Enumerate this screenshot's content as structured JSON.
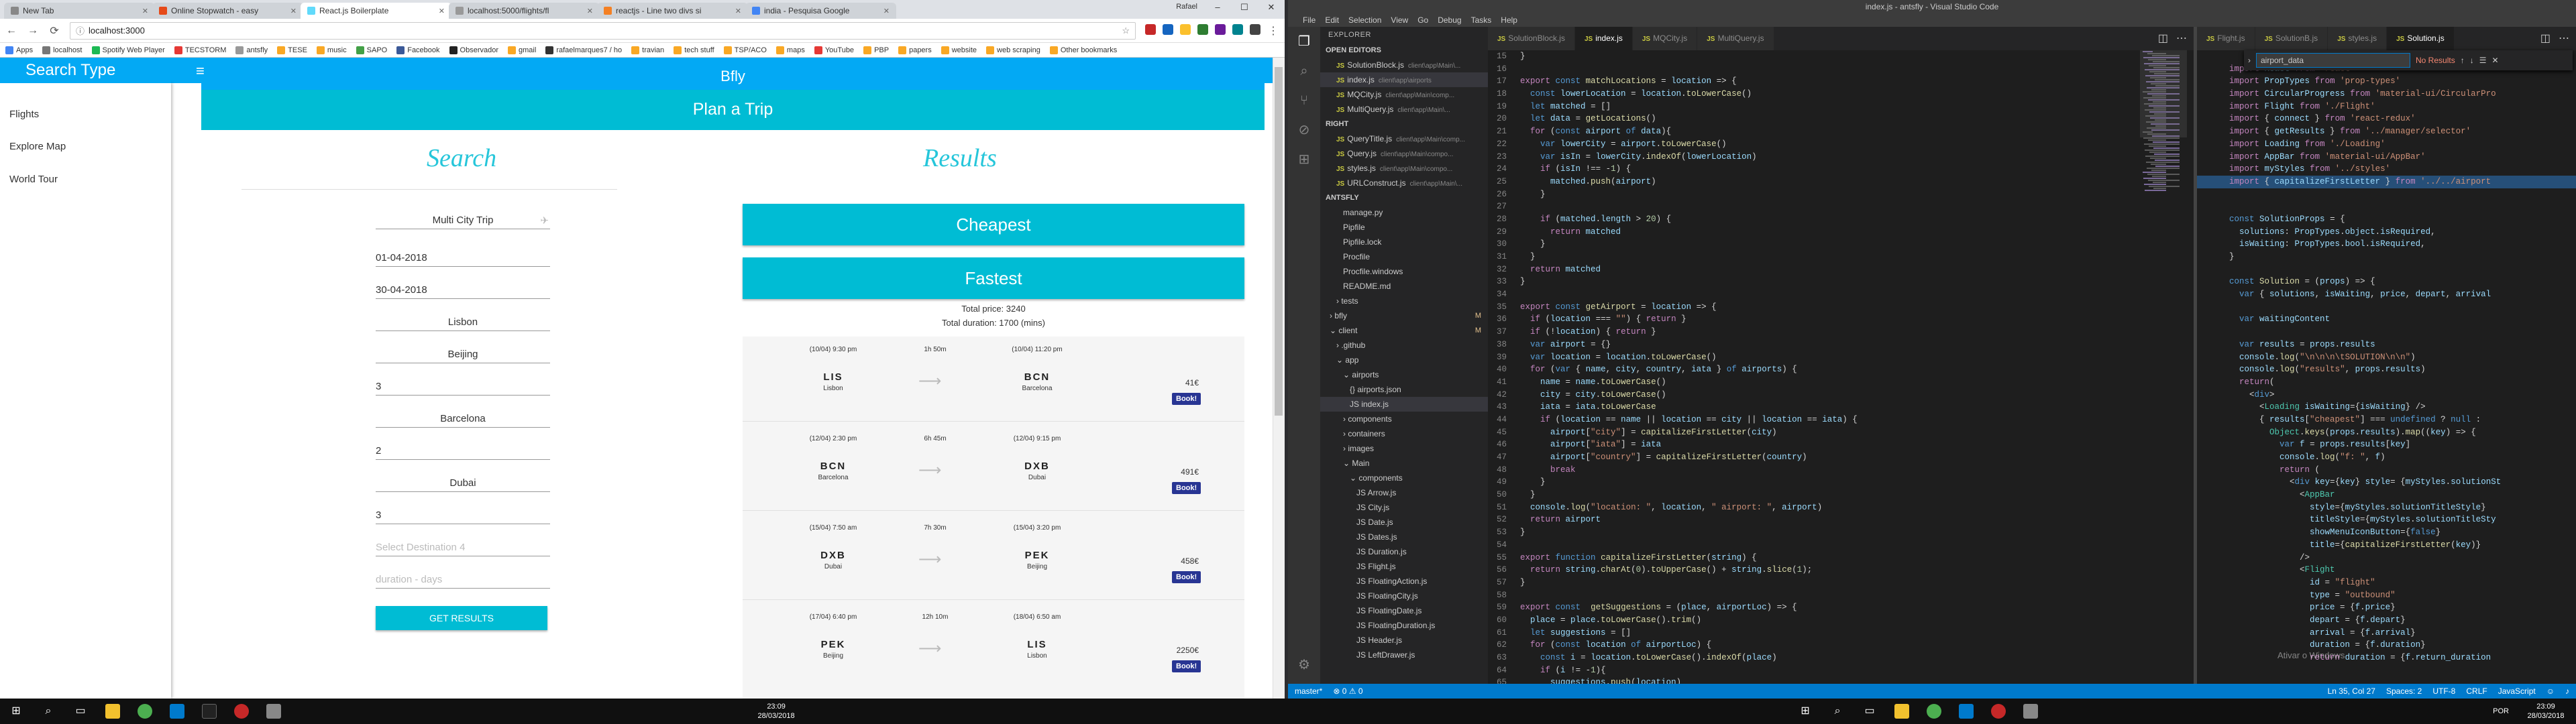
{
  "browser": {
    "tabs": [
      {
        "title": "New Tab",
        "color": "#888"
      },
      {
        "title": "Online Stopwatch - easy",
        "color": "#e64a19"
      },
      {
        "title": "React.js Boilerplate",
        "color": "#61dafb"
      },
      {
        "title": "localhost:5000/flights/fl",
        "color": "#999"
      },
      {
        "title": "reactjs - Line two divs si",
        "color": "#f48024"
      },
      {
        "title": "india - Pesquisa Google",
        "color": "#4285f4"
      }
    ],
    "user": "Rafael",
    "url": "localhost:3000",
    "bookmarks": [
      {
        "label": "Apps",
        "color": "#4285f4"
      },
      {
        "label": "localhost",
        "color": "#777"
      },
      {
        "label": "Spotify Web Player",
        "color": "#1db954"
      },
      {
        "label": "TECSTORM",
        "color": "#e53935"
      },
      {
        "label": "antsfly",
        "color": "#999"
      },
      {
        "label": "TESE",
        "color": "#f9a825"
      },
      {
        "label": "music",
        "color": "#f9a825"
      },
      {
        "label": "SAPO",
        "color": "#43a047"
      },
      {
        "label": "Facebook",
        "color": "#3b5998"
      },
      {
        "label": "Observador",
        "color": "#222"
      },
      {
        "label": "gmail",
        "color": "#f9a825"
      },
      {
        "label": "rafaelmarques7 / ho",
        "color": "#333"
      },
      {
        "label": "travian",
        "color": "#f9a825"
      },
      {
        "label": "tech stuff",
        "color": "#f9a825"
      },
      {
        "label": "TSP/ACO",
        "color": "#f9a825"
      },
      {
        "label": "maps",
        "color": "#f9a825"
      },
      {
        "label": "YouTube",
        "color": "#e53935"
      },
      {
        "label": "PBP",
        "color": "#f9a825"
      },
      {
        "label": "papers",
        "color": "#f9a825"
      },
      {
        "label": "website",
        "color": "#f9a825"
      },
      {
        "label": "web scraping",
        "color": "#f9a825"
      },
      {
        "label": "Other bookmarks",
        "color": "#f9a825"
      }
    ]
  },
  "app": {
    "drawer_title": "Search Type",
    "nav": [
      "Flights",
      "Explore Map",
      "World Tour"
    ],
    "brand": "Bfly",
    "header": "Plan a Trip",
    "search": {
      "title": "Search",
      "mode": "Multi City Trip",
      "date_from": "01-04-2018",
      "date_to": "30-04-2018",
      "origin": "Lisbon",
      "destinations": [
        {
          "city": "Beijing",
          "days": "3"
        },
        {
          "city": "Barcelona",
          "days": "2"
        },
        {
          "city": "Dubai",
          "days": "3"
        }
      ],
      "dest_placeholder": "Select Destination 4",
      "days_placeholder": "duration - days",
      "submit": "GET RESULTS"
    },
    "results": {
      "title": "Results",
      "cheapest": "Cheapest",
      "fastest": "Fastest",
      "total_price": "Total price: 3240",
      "total_duration": "Total duration: 1700 (mins)",
      "book_label": "Book!",
      "flights": [
        {
          "dep_time": "(10/04) 9:30 pm",
          "duration": "1h 50m",
          "arr_time": "(10/04) 11:20 pm",
          "from_code": "LIS",
          "from_city": "Lisbon",
          "to_code": "BCN",
          "to_city": "Barcelona",
          "price": "41€"
        },
        {
          "dep_time": "(12/04) 2:30 pm",
          "duration": "6h 45m",
          "arr_time": "(12/04) 9:15 pm",
          "from_code": "BCN",
          "from_city": "Barcelona",
          "to_code": "DXB",
          "to_city": "Dubai",
          "price": "491€"
        },
        {
          "dep_time": "(15/04) 7:50 am",
          "duration": "7h 30m",
          "arr_time": "(15/04) 3:20 pm",
          "from_code": "DXB",
          "from_city": "Dubai",
          "to_code": "PEK",
          "to_city": "Beijing",
          "price": "458€"
        },
        {
          "dep_time": "(17/04) 6:40 pm",
          "duration": "12h 10m",
          "arr_time": "(18/04) 6:50 am",
          "from_code": "PEK",
          "from_city": "Beijing",
          "to_code": "LIS",
          "to_city": "Lisbon",
          "price": "2250€"
        }
      ]
    }
  },
  "vscode": {
    "title": "index.js - antsfly - Visual Studio Code",
    "menu": [
      "File",
      "Edit",
      "Selection",
      "View",
      "Go",
      "Debug",
      "Tasks",
      "Help"
    ],
    "explorer_label": "EXPLORER",
    "open_editors_label": "OPEN EDITORS",
    "open_editors": [
      {
        "name": "SolutionBlock.js",
        "path": "client\\app\\Main\\..."
      },
      {
        "name": "index.js",
        "path": "client\\app\\airports"
      },
      {
        "name": "MQCity.js",
        "path": "client\\app\\Main\\comp..."
      },
      {
        "name": "MultiQuery.js",
        "path": "client\\app\\Main\\..."
      }
    ],
    "right_label": "RIGHT",
    "right_editors": [
      {
        "name": "QueryTitle.js",
        "path": "client\\app\\Main\\comp..."
      },
      {
        "name": "Query.js",
        "path": "client\\app\\Main\\compo..."
      },
      {
        "name": "styles.js",
        "path": "client\\app\\Main\\compo..."
      },
      {
        "name": "URLConstruct.js",
        "path": "client\\app\\Main\\..."
      }
    ],
    "project_label": "ANTSFLY",
    "tree": [
      {
        "name": "manage.py",
        "depth": 2,
        "mod": ""
      },
      {
        "name": "Pipfile",
        "depth": 2,
        "mod": ""
      },
      {
        "name": "Pipfile.lock",
        "depth": 2,
        "mod": ""
      },
      {
        "name": "Procfile",
        "depth": 2,
        "mod": ""
      },
      {
        "name": "Procfile.windows",
        "depth": 2,
        "mod": ""
      },
      {
        "name": "README.md",
        "depth": 2,
        "mod": ""
      },
      {
        "name": "› tests",
        "depth": 1,
        "mod": ""
      },
      {
        "name": "› bfly",
        "depth": 0,
        "mod": "M"
      },
      {
        "name": "⌄ client",
        "depth": 0,
        "mod": "M"
      },
      {
        "name": "› .github",
        "depth": 1,
        "mod": ""
      },
      {
        "name": "⌄ app",
        "depth": 1,
        "mod": ""
      },
      {
        "name": "⌄ airports",
        "depth": 2,
        "mod": ""
      },
      {
        "name": "{} airports.json",
        "depth": 3,
        "mod": ""
      },
      {
        "name": "JS index.js",
        "depth": 3,
        "mod": ""
      },
      {
        "name": "› components",
        "depth": 2,
        "mod": ""
      },
      {
        "name": "› containers",
        "depth": 2,
        "mod": ""
      },
      {
        "name": "› images",
        "depth": 2,
        "mod": ""
      },
      {
        "name": "⌄ Main",
        "depth": 2,
        "mod": ""
      },
      {
        "name": "⌄ components",
        "depth": 3,
        "mod": ""
      },
      {
        "name": "JS Arrow.js",
        "depth": 4,
        "mod": ""
      },
      {
        "name": "JS City.js",
        "depth": 4,
        "mod": ""
      },
      {
        "name": "JS Date.js",
        "depth": 4,
        "mod": ""
      },
      {
        "name": "JS Dates.js",
        "depth": 4,
        "mod": ""
      },
      {
        "name": "JS Duration.js",
        "depth": 4,
        "mod": ""
      },
      {
        "name": "JS Flight.js",
        "depth": 4,
        "mod": ""
      },
      {
        "name": "JS FloatingAction.js",
        "depth": 4,
        "mod": ""
      },
      {
        "name": "JS FloatingCity.js",
        "depth": 4,
        "mod": ""
      },
      {
        "name": "JS FloatingDate.js",
        "depth": 4,
        "mod": ""
      },
      {
        "name": "JS FloatingDuration.js",
        "depth": 4,
        "mod": ""
      },
      {
        "name": "JS Header.js",
        "depth": 4,
        "mod": ""
      },
      {
        "name": "JS LeftDrawer.js",
        "depth": 4,
        "mod": ""
      }
    ],
    "left_tabs": [
      "SolutionBlock.js",
      "index.js",
      "MQCity.js",
      "MultiQuery.js"
    ],
    "right_tabs": [
      "Flight.js",
      "SolutionB.js",
      "styles.js",
      "Solution.js"
    ],
    "find": {
      "value": "airport_data",
      "result": "No Results"
    },
    "status": {
      "branch": "master*",
      "errors": "⊗ 0 ⚠ 0",
      "position": "Ln 35, Col 27",
      "spaces": "Spaces: 2",
      "encoding": "UTF-8",
      "eol": "CRLF",
      "lang": "JavaScript"
    },
    "activate_windows": "Ativar o Windows"
  },
  "taskbar": {
    "time_left": "23:09",
    "date_left": "28/03/2018",
    "lang": "POR",
    "time_right": "23:09",
    "date_right": "28/03/2018"
  }
}
